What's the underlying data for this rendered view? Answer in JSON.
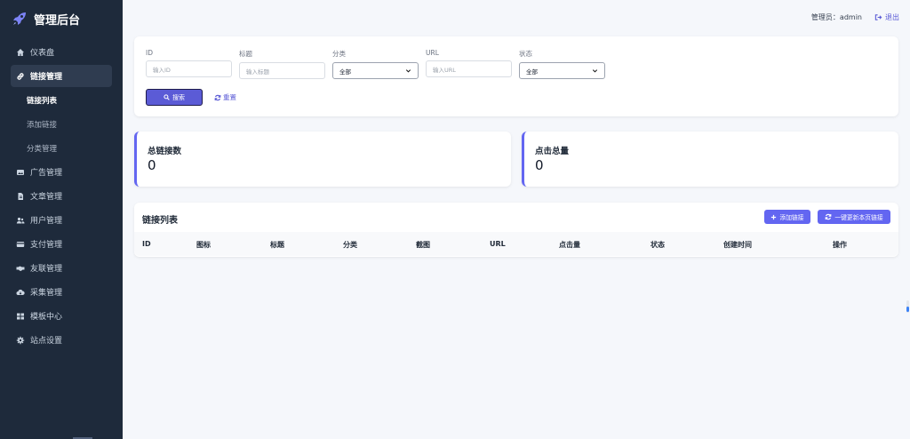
{
  "brand": {
    "title": "管理后台",
    "icon": "rocket-icon"
  },
  "sidebar": {
    "items": [
      {
        "label": "仪表盘",
        "icon": "home-icon"
      },
      {
        "label": "链接管理",
        "icon": "link-icon",
        "active": true,
        "children": [
          {
            "label": "链接列表",
            "current": true
          },
          {
            "label": "添加链接"
          },
          {
            "label": "分类管理"
          }
        ]
      },
      {
        "label": "广告管理",
        "icon": "image-icon"
      },
      {
        "label": "文章管理",
        "icon": "file-icon"
      },
      {
        "label": "用户管理",
        "icon": "users-icon"
      },
      {
        "label": "支付管理",
        "icon": "credit-card-icon"
      },
      {
        "label": "友联管理",
        "icon": "handshake-icon"
      },
      {
        "label": "采集管理",
        "icon": "cloud-download-icon"
      },
      {
        "label": "模板中心",
        "icon": "grid-icon"
      },
      {
        "label": "站点设置",
        "icon": "gear-icon"
      }
    ]
  },
  "topbar": {
    "admin_label": "管理员：admin",
    "logout_label": "退出"
  },
  "filter": {
    "id": {
      "label": "ID",
      "placeholder": "输入ID"
    },
    "title": {
      "label": "标题",
      "placeholder": "输入标题"
    },
    "category": {
      "label": "分类",
      "selected": "全部"
    },
    "url": {
      "label": "URL",
      "placeholder": "输入URL"
    },
    "status": {
      "label": "状态",
      "selected": "全部"
    },
    "search_label": "搜索",
    "reset_label": "重置"
  },
  "stats": [
    {
      "title": "总链接数",
      "value": "0"
    },
    {
      "title": "点击总量",
      "value": "0"
    }
  ],
  "list": {
    "title": "链接列表",
    "add_label": "添加链接",
    "refresh_label": "一键更新本页链接",
    "columns": [
      "ID",
      "图标",
      "标题",
      "分类",
      "截图",
      "URL",
      "点击量",
      "状态",
      "创建时间",
      "操作"
    ]
  },
  "colors": {
    "sidebar_bg": "#1e2a3b",
    "accent": "#6366f1",
    "page_bg": "#f5f7fb"
  }
}
